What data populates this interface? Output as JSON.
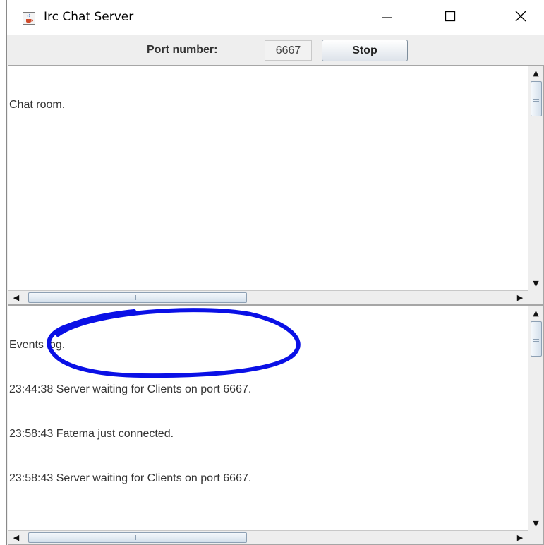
{
  "window": {
    "title": "Irc Chat Server",
    "icon": "java-cup-icon",
    "controls": [
      "minimize-icon",
      "maximize-icon",
      "close-icon"
    ]
  },
  "toolbar": {
    "port_label": "Port number:",
    "port_value": "6667",
    "stop_label": "Stop"
  },
  "chat_room": {
    "lines": [
      "Chat room."
    ]
  },
  "events_log": {
    "lines": [
      "Events log.",
      "23:44:38 Server waiting for Clients on port 6667.",
      "23:58:43 Fatema just connected.",
      "23:58:43 Server waiting for Clients on port 6667."
    ]
  },
  "annotation": {
    "shape": "hand-drawn ellipse",
    "color": "#0a10e6"
  },
  "colors": {
    "thumb_border": "#8da0b4",
    "window_bg": "#eeeeee"
  }
}
